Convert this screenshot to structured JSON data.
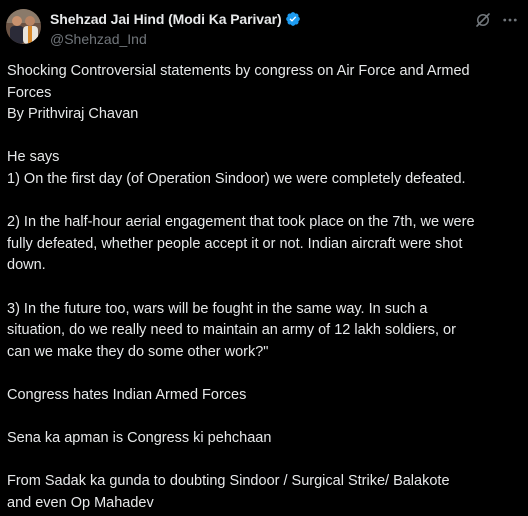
{
  "author": {
    "display_name": "Shehzad Jai Hind (Modi Ka Parivar)",
    "handle": "@Shehzad_Ind",
    "verified": true
  },
  "icons": {
    "verified": "verified-badge-icon",
    "grok": "grok-icon",
    "more": "more-options-icon"
  },
  "colors": {
    "background": "#000000",
    "text": "#e7e9ea",
    "secondary_text": "#71767b",
    "verified_blue": "#1d9bf0"
  },
  "post": {
    "lines": [
      "Shocking Controversial statements by congress on Air Force and Armed",
      "Forces",
      "By Prithviraj Chavan",
      "",
      "He says",
      "1) On the first day (of Operation Sindoor) we were completely defeated.",
      "",
      "2) In the half-hour aerial engagement that took place on the 7th, we were",
      "fully defeated, whether people accept it or not. Indian aircraft were shot",
      "down.",
      "",
      "3) In the future too, wars will be fought in the same way. In such a",
      "situation, do we really need to maintain an army of 12 lakh soldiers, or",
      "can we make they do some other work?\"",
      "",
      "Congress hates Indian Armed Forces",
      "",
      "Sena ka apman is Congress ki pehchaan",
      "",
      "From Sadak ka gunda to doubting Sindoor / Surgical Strike/ Balakote",
      "and even Op Mahadev"
    ]
  }
}
